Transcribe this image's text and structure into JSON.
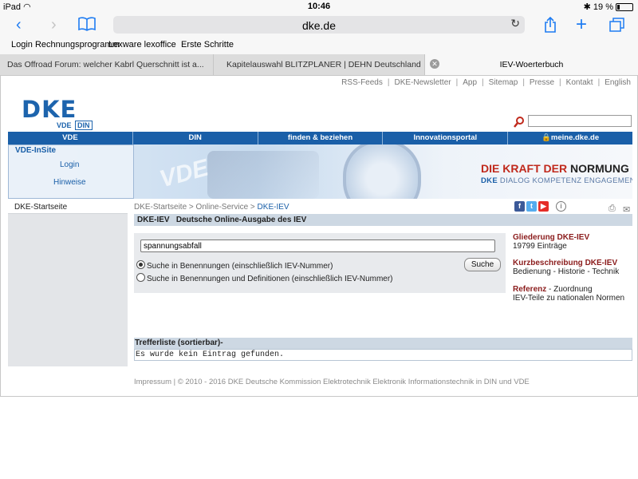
{
  "status_bar": {
    "device": "iPad",
    "time": "10:46",
    "battery": "19 %"
  },
  "browser": {
    "url": "dke.de",
    "favorites": [
      "Login Rechnungsprogramm",
      "Lexware lexoffice",
      "Erste Schritte"
    ],
    "tabs": [
      "Das Offroad Forum: welcher Kabrl Querschnitt ist a...",
      "Kapitelauswahl BLITZPLANER | DEHN Deutschland",
      "IEV-Woerterbuch"
    ]
  },
  "top_links": [
    "RSS-Feeds",
    "DKE-Newsletter",
    "App",
    "Sitemap",
    "Presse",
    "Kontakt",
    "English"
  ],
  "logo": {
    "name": "DKE",
    "sub_vde": "VDE",
    "sub_din": "DIN"
  },
  "nav": [
    "VDE",
    "DIN",
    "finden & beziehen",
    "Innovationsportal",
    "meine.dke.de"
  ],
  "insite": {
    "title": "VDE-InSite",
    "login": "Login",
    "hinweise": "Hinweise"
  },
  "banner": {
    "art_text": "VDE",
    "slogan_a": "DIE KRAFT DER ",
    "slogan_b": "NORMUNG",
    "slogan2_a": "DKE",
    "slogan2_b": " DIALOG  KOMPETENZ  ENGAGEMENT"
  },
  "left_nav": [
    "DKE-Startseite"
  ],
  "breadcrumb": {
    "items": [
      "DKE-Startseite",
      "Online-Service"
    ],
    "current": "DKE-IEV",
    "sep": " > "
  },
  "page_title": "DKE-IEV   Deutsche Online-Ausgabe des IEV",
  "search": {
    "query": "spannungsabfall",
    "option1": "Suche in Benennungen (einschließlich IEV-Nummer)",
    "option2": "Suche in Benennungen und Definitionen (einschließlich IEV-Nummer)",
    "button": "Suche"
  },
  "info": [
    {
      "head": "Gliederung DKE-IEV",
      "text": "19799 Einträge"
    },
    {
      "head": "Kurzbeschreibung DKE-IEV",
      "text": "Bedienung - Historie - Technik"
    },
    {
      "head": "Referenz",
      "head_suffix": " - Zuordnung",
      "text": "IEV-Teile zu nationalen Normen"
    }
  ],
  "results": {
    "header": "Trefferliste (sortierbar)-",
    "message": "Es wurde kein Eintrag gefunden."
  },
  "footer": "Impressum | © 2010 - 2016 DKE  Deutsche Kommission Elektrotechnik Elektronik Informationstechnik in DIN und VDE",
  "colors": {
    "brand_blue": "#1a5fa8",
    "accent_red": "#c0291c",
    "link_dark_red": "#8b1c1c"
  }
}
